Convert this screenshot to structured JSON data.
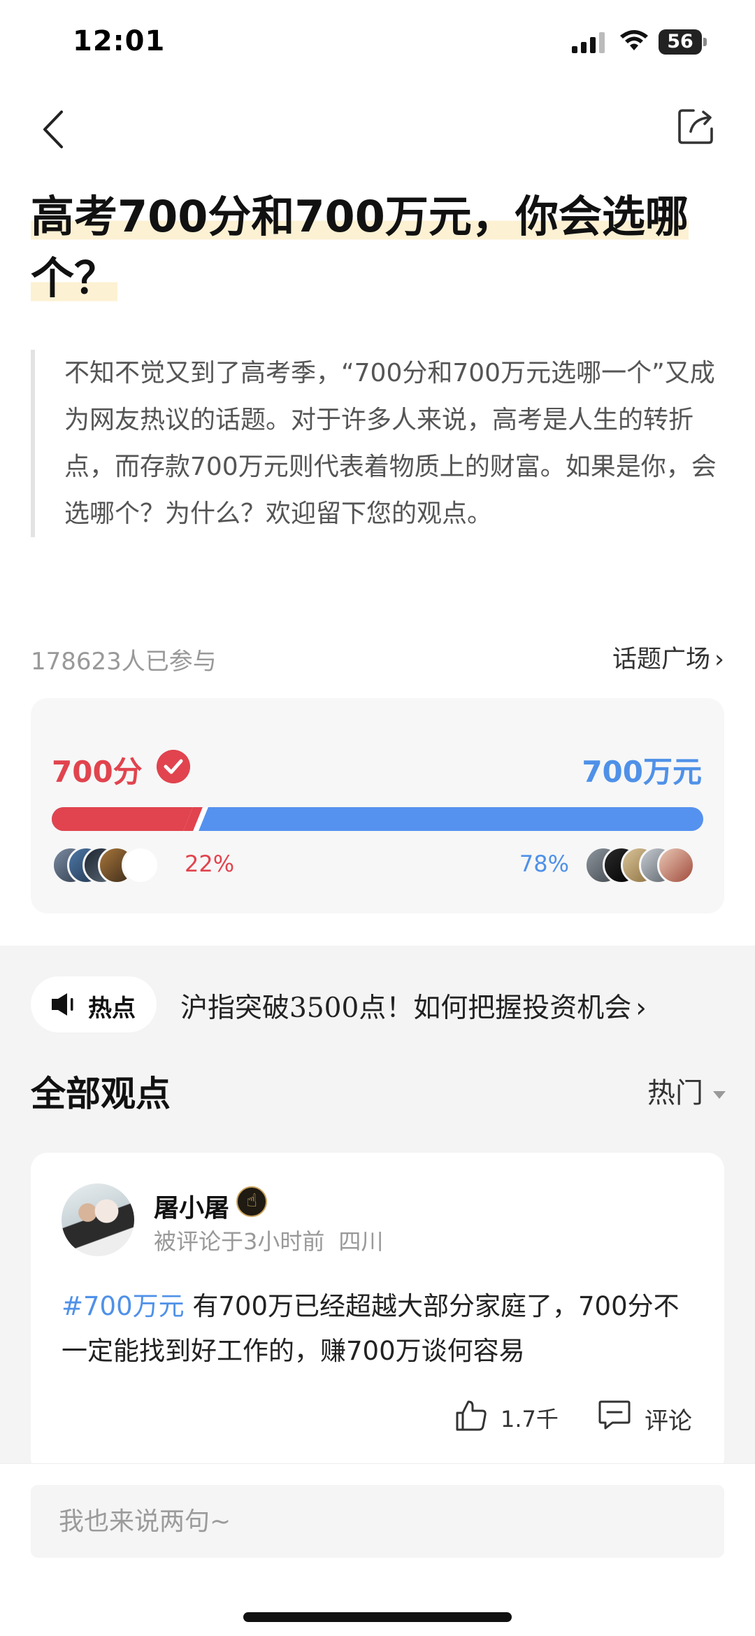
{
  "status_bar": {
    "time": "12:01",
    "battery": "56"
  },
  "nav": {
    "back_icon": "chevron-left-icon",
    "share_icon": "share-icon"
  },
  "title": "高考700分和700万元，你会选哪个？",
  "description": "不知不觉又到了高考季，“700分和700万元选哪一个”又成为网友热议的话题。对于许多人来说，高考是人生的转折点，而存款700万元则代表着物质上的财富。如果是你，会选哪个？为什么？欢迎留下您的观点。",
  "participation": {
    "count_text": "178623人已参与",
    "square_link": "话题广场",
    "square_chevron": "›"
  },
  "vote": {
    "left_option": "700分",
    "right_option": "700万元",
    "left_percent_text": "22%",
    "right_percent_text": "78%",
    "left_fraction": 0.22,
    "right_fraction": 0.78,
    "selected": "left",
    "left_color": "#e1444e",
    "right_color": "#5591ef"
  },
  "hot": {
    "label": "热点",
    "text": "沪指突破3500点！如何把握投资机会",
    "chevron": "›"
  },
  "views": {
    "heading": "全部观点",
    "sort_label": "热门"
  },
  "comment": {
    "author": "屠小屠",
    "meta_time": "被评论于3小时前",
    "meta_location": "四川",
    "tag": "#700万元",
    "text": " 有700万已经超越大部分家庭了，700分不一定能找到好工作的，赚700万谈何容易",
    "like_count": "1.7千",
    "comment_label": "评论"
  },
  "input": {
    "placeholder": "我也来说两句~"
  }
}
